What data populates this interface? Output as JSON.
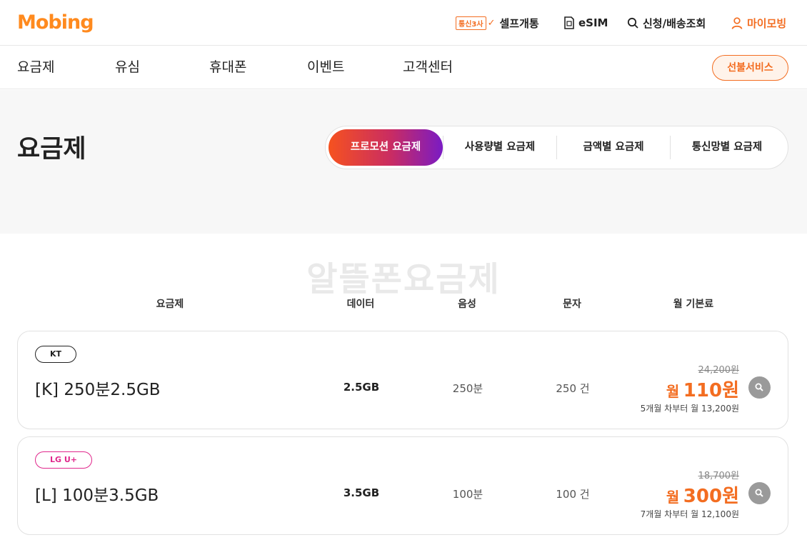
{
  "header": {
    "logo": "Mobing",
    "util": {
      "telecom3_badge": "통신3사",
      "self_open": "셀프개통",
      "esim": "eSIM",
      "apply_check": "신청/배송조회",
      "my_mobing": "마이모빙"
    }
  },
  "nav": {
    "items": [
      "요금제",
      "유심",
      "휴대폰",
      "이벤트",
      "고객센터"
    ],
    "prepaid": "선불서비스"
  },
  "page": {
    "title": "요금제",
    "tabs": [
      "프로모션 요금제",
      "사용량별 요금제",
      "금액별 요금제",
      "통신망별 요금제"
    ],
    "active_tab": 0
  },
  "section": {
    "watermark": "알뜰폰요금제",
    "columns": [
      "요금제",
      "데이터",
      "음성",
      "문자",
      "월 기본료"
    ]
  },
  "plans": [
    {
      "carrier": "KT",
      "name": "[K] 250분2.5GB",
      "data": "2.5GB",
      "voice": "250분",
      "sms": "250 건",
      "original_price": "24,200원",
      "price_prefix": "월",
      "price": "110원",
      "after": "5개월 차부터 월 13,200원"
    },
    {
      "carrier": "LG U+",
      "name": "[L] 100분3.5GB",
      "data": "3.5GB",
      "voice": "100분",
      "sms": "100 건",
      "original_price": "18,700원",
      "price_prefix": "월",
      "price": "300원",
      "after": "7개월 차부터 월 12,100원"
    }
  ],
  "colors": {
    "accent": "#f36d21",
    "tab_gradient_start": "#f6521f",
    "tab_gradient_end": "#7a1bc4",
    "lg_magenta": "#e0288c",
    "band": "#f7f7f7"
  },
  "icons": [
    "self-open-check-icon",
    "sim-card-icon",
    "search-icon",
    "user-icon",
    "zoom-icon"
  ]
}
